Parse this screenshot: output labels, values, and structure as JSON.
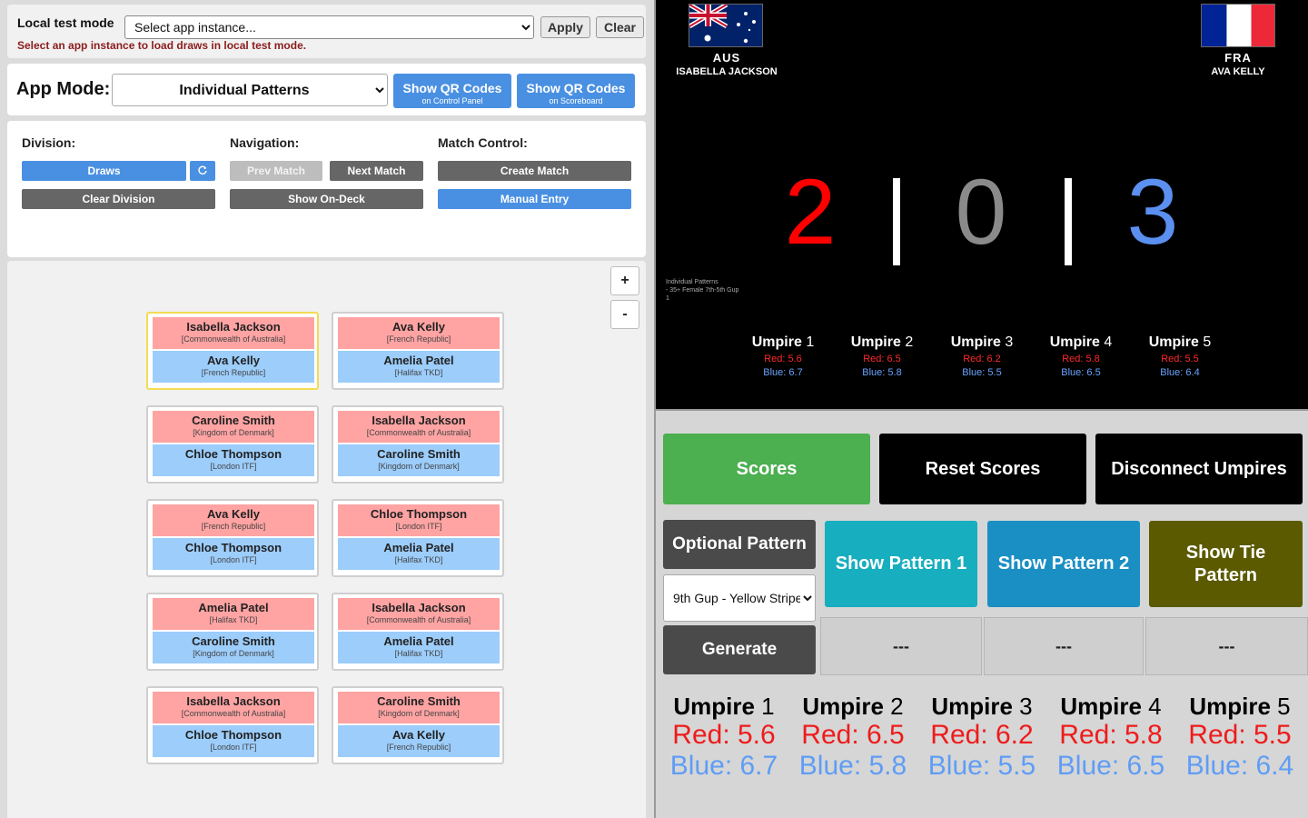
{
  "test_mode": {
    "label": "Local test mode",
    "select_value": "Select app instance...",
    "apply_label": "Apply",
    "clear_label": "Clear",
    "hint": "Select an app instance to load draws in local test mode."
  },
  "app_mode": {
    "label": "App Mode:",
    "value": "Individual Patterns",
    "qr_control": {
      "title": "Show QR Codes",
      "sub": "on Control Panel"
    },
    "qr_scoreboard": {
      "title": "Show QR Codes",
      "sub": "on Scoreboard"
    }
  },
  "controls": {
    "division_title": "Division:",
    "navigation_title": "Navigation:",
    "match_control_title": "Match Control:",
    "draws_label": "Draws",
    "clear_division_label": "Clear Division",
    "prev_match_label": "Prev Match",
    "next_match_label": "Next Match",
    "show_on_deck_label": "Show On-Deck",
    "create_match_label": "Create Match",
    "manual_entry_label": "Manual Entry"
  },
  "zoom": {
    "in_label": "+",
    "out_label": "-"
  },
  "matches": [
    {
      "red": {
        "name": "Isabella Jackson",
        "country": "[Commonwealth of Australia]"
      },
      "blue": {
        "name": "Ava Kelly",
        "country": "[French Republic]"
      }
    },
    {
      "red": {
        "name": "Ava Kelly",
        "country": "[French Republic]"
      },
      "blue": {
        "name": "Amelia Patel",
        "country": "[Halifax TKD]"
      }
    },
    {
      "red": {
        "name": "Caroline Smith",
        "country": "[Kingdom of Denmark]"
      },
      "blue": {
        "name": "Chloe Thompson",
        "country": "[London ITF]"
      }
    },
    {
      "red": {
        "name": "Isabella Jackson",
        "country": "[Commonwealth of Australia]"
      },
      "blue": {
        "name": "Caroline Smith",
        "country": "[Kingdom of Denmark]"
      }
    },
    {
      "red": {
        "name": "Ava Kelly",
        "country": "[French Republic]"
      },
      "blue": {
        "name": "Chloe Thompson",
        "country": "[London ITF]"
      }
    },
    {
      "red": {
        "name": "Chloe Thompson",
        "country": "[London ITF]"
      },
      "blue": {
        "name": "Amelia Patel",
        "country": "[Halifax TKD]"
      }
    },
    {
      "red": {
        "name": "Amelia Patel",
        "country": "[Halifax TKD]"
      },
      "blue": {
        "name": "Caroline Smith",
        "country": "[Kingdom of Denmark]"
      }
    },
    {
      "red": {
        "name": "Isabella Jackson",
        "country": "[Commonwealth of Australia]"
      },
      "blue": {
        "name": "Amelia Patel",
        "country": "[Halifax TKD]"
      }
    },
    {
      "red": {
        "name": "Isabella Jackson",
        "country": "[Commonwealth of Australia]"
      },
      "blue": {
        "name": "Chloe Thompson",
        "country": "[London ITF]"
      }
    },
    {
      "red": {
        "name": "Caroline Smith",
        "country": "[Kingdom of Denmark]"
      },
      "blue": {
        "name": "Ava Kelly",
        "country": "[French Republic]"
      }
    }
  ],
  "scoreboard": {
    "red_athlete": {
      "code": "AUS",
      "name": "ISABELLA JACKSON"
    },
    "blue_athlete": {
      "code": "FRA",
      "name": "AVA KELLY"
    },
    "red_score": "2",
    "tie_score": "0",
    "blue_score": "3",
    "separator": "|",
    "division_line1": "Individual Patterns",
    "division_line2": "- 35+ Female 7th-5th Gup",
    "division_line3": "1",
    "colors": {
      "red": "#ff0000",
      "tie": "#8a8a8a",
      "blue": "#5b8ff0"
    }
  },
  "umpires": [
    {
      "label": "Umpire",
      "num": "1",
      "red": "Red: 5.6",
      "blue": "Blue: 6.7"
    },
    {
      "label": "Umpire",
      "num": "2",
      "red": "Red: 6.5",
      "blue": "Blue: 5.8"
    },
    {
      "label": "Umpire",
      "num": "3",
      "red": "Red: 6.2",
      "blue": "Blue: 5.5"
    },
    {
      "label": "Umpire",
      "num": "4",
      "red": "Red: 5.8",
      "blue": "Blue: 6.5"
    },
    {
      "label": "Umpire",
      "num": "5",
      "red": "Red: 5.5",
      "blue": "Blue: 6.4"
    }
  ],
  "actions": {
    "scores_label": "Scores",
    "reset_label": "Reset Scores",
    "disconnect_label": "Disconnect Umpires",
    "optional_pattern_label": "Optional Pattern",
    "pattern_select_value": "9th Gup - Yellow Stripe",
    "generate_label": "Generate",
    "show_pattern1_label": "Show Pattern 1",
    "show_pattern2_label": "Show Pattern 2",
    "show_tie_label": "Show Tie Pattern",
    "placeholder_1": "---",
    "placeholder_2": "---",
    "placeholder_3": "---",
    "colors": {
      "scores": "#4caf50",
      "black": "#000000",
      "dark": "#4a4a4a",
      "teal": "#17aebf",
      "blue": "#1a8fc4",
      "olive": "#5b5a00"
    }
  },
  "icons": {
    "refresh": "refresh-icon",
    "dropdown": "chevron-down-icon"
  }
}
